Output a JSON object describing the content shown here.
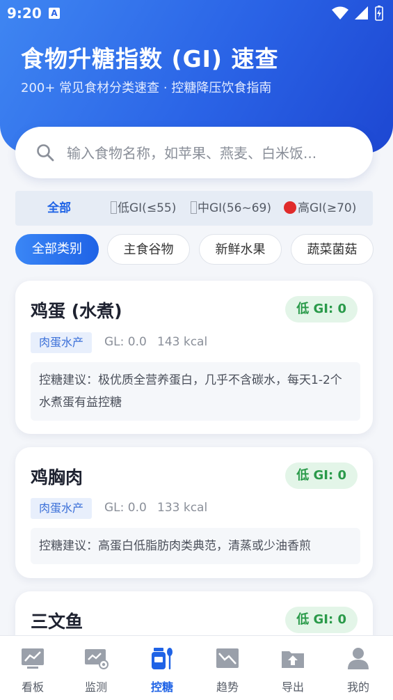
{
  "status": {
    "time": "9:20",
    "a_icon": "A"
  },
  "header": {
    "title": "食物升糖指数 (GI) 速查",
    "subtitle": "200+ 常见食材分类速查 · 控糖降压饮食指南"
  },
  "search": {
    "placeholder": "输入食物名称，如苹果、燕麦、白米饭..."
  },
  "gi_tabs": [
    {
      "label": "全部",
      "active": true
    },
    {
      "label": "低GI(≤55)",
      "marker": "placeholder-glyph"
    },
    {
      "label": "中GI(56~69)",
      "marker": "placeholder-glyph"
    },
    {
      "label": "高GI(≥70)",
      "marker": "red-circle",
      "color": "#e02b2b"
    }
  ],
  "categories": [
    {
      "label": "全部类别",
      "active": true
    },
    {
      "label": "主食谷物"
    },
    {
      "label": "新鲜水果"
    },
    {
      "label": "蔬菜菌菇"
    }
  ],
  "foods": [
    {
      "name": "鸡蛋 (水煮)",
      "gi_badge": "低 GI: 0",
      "category": "肉蛋水产",
      "gl": "GL: 0.0",
      "kcal": "143 kcal",
      "advice": "控糖建议：极优质全营养蛋白，几乎不含碳水，每天1-2个水煮蛋有益控糖"
    },
    {
      "name": "鸡胸肉",
      "gi_badge": "低 GI: 0",
      "category": "肉蛋水产",
      "gl": "GL: 0.0",
      "kcal": "133 kcal",
      "advice": "控糖建议：高蛋白低脂肪肉类典范，清蒸或少油香煎"
    },
    {
      "name": "三文鱼",
      "gi_badge": "低 GI: 0"
    }
  ],
  "nav": [
    {
      "label": "看板",
      "icon": "dashboard-chart-icon"
    },
    {
      "label": "监测",
      "icon": "monitor-icon"
    },
    {
      "label": "控糖",
      "icon": "food-jar-spoon-icon",
      "active": true
    },
    {
      "label": "趋势",
      "icon": "trend-icon"
    },
    {
      "label": "导出",
      "icon": "export-folder-icon"
    },
    {
      "label": "我的",
      "icon": "user-icon"
    }
  ],
  "colors": {
    "accent": "#1f63e6",
    "low_gi_bg": "#e3f5e8",
    "low_gi_text": "#2a9a4a",
    "tag_bg": "#e8effc",
    "tag_text": "#3a6fd8"
  }
}
